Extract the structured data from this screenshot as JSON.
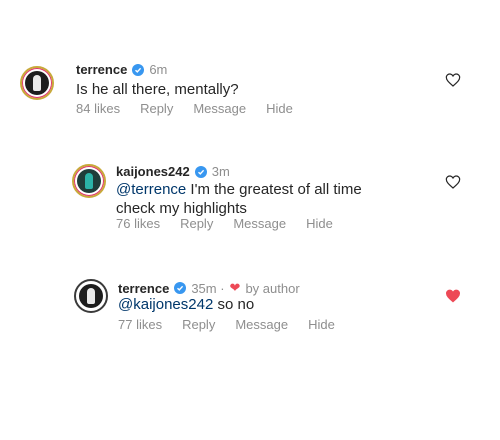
{
  "comments": [
    {
      "username": "terrence",
      "time": "6m",
      "by_author": "",
      "mention": "",
      "text": "Is he all there, mentally?",
      "text_line2": "",
      "likes": "84 likes",
      "reply": "Reply",
      "message": "Message",
      "hide": "Hide",
      "liked": false
    },
    {
      "username": "kaijones242",
      "time": "3m",
      "by_author": "",
      "mention": "@terrence",
      "text": " I'm the greatest of all time",
      "text_line2": "check my highlights",
      "likes": "76 likes",
      "reply": "Reply",
      "message": "Message",
      "hide": "Hide",
      "liked": false
    },
    {
      "username": "terrence",
      "time": "35m ·",
      "by_author": "by author",
      "mention": "@kaijones242",
      "text": " so no",
      "text_line2": "",
      "likes": "77 likes",
      "reply": "Reply",
      "message": "Message",
      "hide": "Hide",
      "liked": true
    }
  ],
  "colors": {
    "verified": "#3897f0",
    "heart_liked": "#ed4956",
    "mention": "#00376b",
    "muted": "#8e8e8e"
  },
  "icons": {
    "verified": "verified-badge-icon",
    "like": "heart-outline-icon",
    "liked": "heart-filled-icon"
  }
}
